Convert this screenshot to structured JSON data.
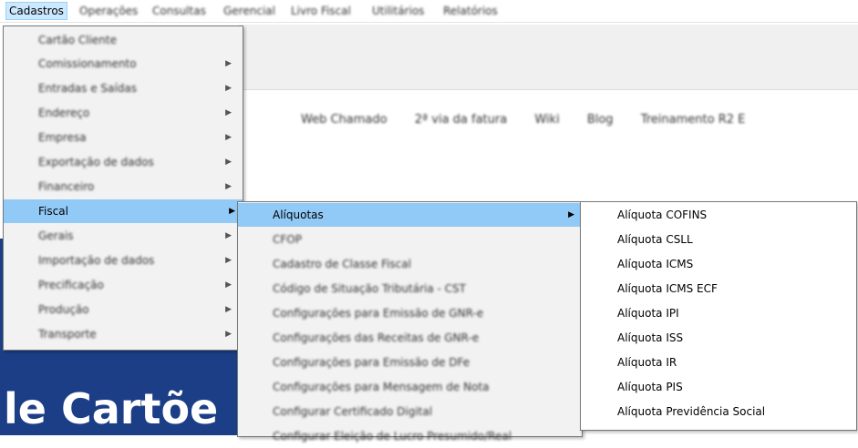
{
  "menubar": {
    "items": [
      {
        "label": "Cadastros",
        "active": true
      },
      {
        "label": "Operações"
      },
      {
        "label": "Consultas"
      },
      {
        "label": "Gerencial"
      },
      {
        "label": "Livro Fiscal"
      },
      {
        "label": "Utilitários"
      },
      {
        "label": "Relatórios"
      }
    ]
  },
  "background": {
    "links": [
      "Web Chamado",
      "2ª via da fatura",
      "Wiki",
      "Blog",
      "Treinamento R2 E"
    ],
    "banner_line1": "",
    "banner_line2": "le Cartõe"
  },
  "cadastros_menu": {
    "items": [
      {
        "label": "Cartão Cliente",
        "submenu": false
      },
      {
        "label": "Comissionamento",
        "submenu": true
      },
      {
        "label": "Entradas e Saídas",
        "submenu": true
      },
      {
        "label": "Endereço",
        "submenu": true
      },
      {
        "label": "Empresa",
        "submenu": true
      },
      {
        "label": "Exportação de dados",
        "submenu": true
      },
      {
        "label": "Financeiro",
        "submenu": true
      },
      {
        "label": "Fiscal",
        "submenu": true,
        "highlighted": true
      },
      {
        "label": "Gerais",
        "submenu": true
      },
      {
        "label": "Importação de dados",
        "submenu": true
      },
      {
        "label": "Precificação",
        "submenu": true
      },
      {
        "label": "Produção",
        "submenu": true
      },
      {
        "label": "Transporte",
        "submenu": true
      }
    ]
  },
  "fiscal_menu": {
    "items": [
      {
        "label": "Alíquotas",
        "submenu": true,
        "highlighted": true
      },
      {
        "label": "CFOP"
      },
      {
        "label": "Cadastro de Classe Fiscal"
      },
      {
        "label": "Código de Situação Tributária - CST"
      },
      {
        "label": "Configurações para Emissão de GNR-e"
      },
      {
        "label": "Configurações das Receitas de GNR-e"
      },
      {
        "label": "Configurações para Emissão de DFe"
      },
      {
        "label": "Configurações para Mensagem de Nota"
      },
      {
        "label": "Configurar Certificado Digital"
      },
      {
        "label": "Configurar Eleição de Lucro Presumido/Real"
      }
    ]
  },
  "aliquotas_menu": {
    "items": [
      {
        "label": "Alíquota COFINS"
      },
      {
        "label": "Alíquota CSLL"
      },
      {
        "label": "Alíquota ICMS"
      },
      {
        "label": "Alíquota ICMS ECF"
      },
      {
        "label": "Alíquota IPI"
      },
      {
        "label": "Alíquota ISS"
      },
      {
        "label": "Alíquota IR"
      },
      {
        "label": "Alíquota PIS"
      },
      {
        "label": "Alíquota Previdência Social"
      }
    ]
  },
  "icons": {
    "submenu_arrow": "triangle-right"
  },
  "colors": {
    "highlight": "#91c9f7",
    "menubar_active": "#cce8ff",
    "banner": "#1b3e86"
  }
}
